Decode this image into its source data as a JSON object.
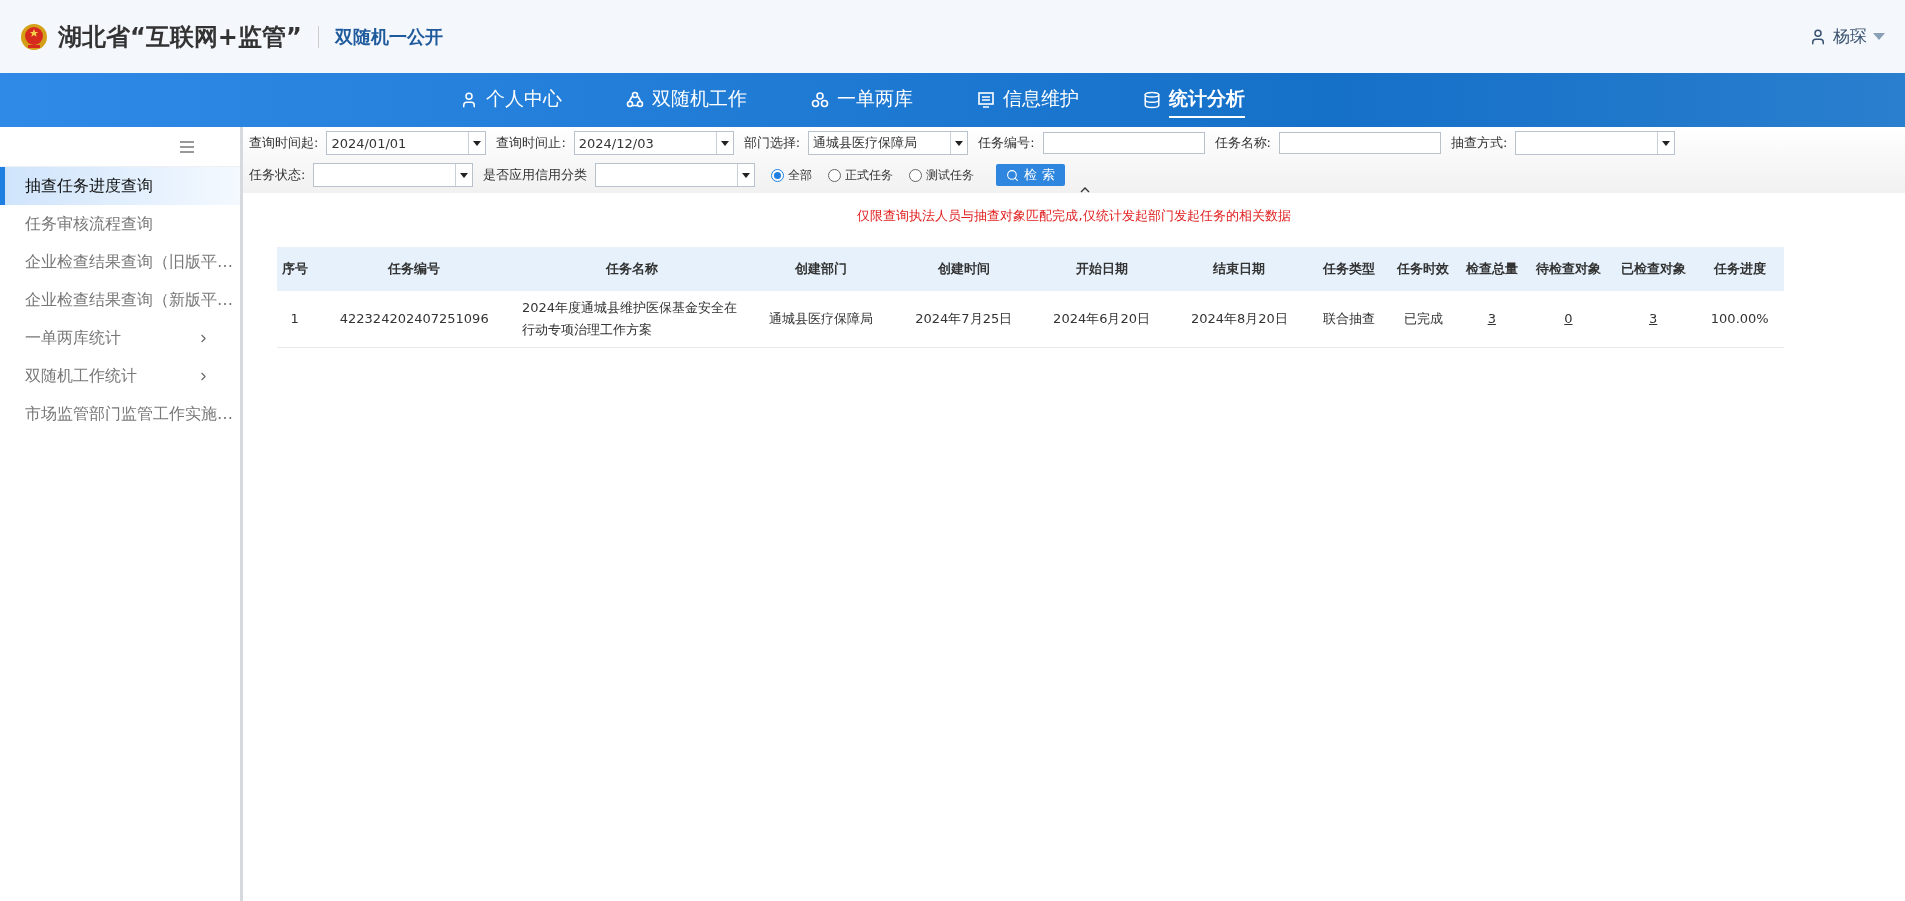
{
  "header": {
    "title": "湖北省“互联网+监管”",
    "subtitle": "双随机一公开",
    "user": "杨琛"
  },
  "nav": [
    {
      "label": "个人中心",
      "selected": false
    },
    {
      "label": "双随机工作",
      "selected": false
    },
    {
      "label": "一单两库",
      "selected": false
    },
    {
      "label": "信息维护",
      "selected": false
    },
    {
      "label": "统计分析",
      "selected": true
    }
  ],
  "sidebar": {
    "items": [
      {
        "label": "抽查任务进度查询",
        "kind": "link",
        "selected": true
      },
      {
        "label": "任务审核流程查询",
        "kind": "link",
        "selected": false
      },
      {
        "label": "企业检查结果查询（旧版平…",
        "kind": "link",
        "selected": false
      },
      {
        "label": "企业检查结果查询（新版平…",
        "kind": "link",
        "selected": false
      },
      {
        "label": "一单两库统计",
        "kind": "group",
        "selected": false
      },
      {
        "label": "双随机工作统计",
        "kind": "group",
        "selected": false
      },
      {
        "label": "市场监管部门监管工作实施…",
        "kind": "link",
        "selected": false
      }
    ]
  },
  "filters": {
    "rows": [
      [
        {
          "label": "查询时间起:",
          "kind": "select",
          "value": "2024/01/01"
        },
        {
          "label": "查询时间止:",
          "kind": "select",
          "value": "2024/12/03"
        },
        {
          "label": "部门选择:",
          "kind": "select",
          "value": "通城县医疗保障局"
        },
        {
          "label": "任务编号:",
          "kind": "input"
        },
        {
          "label": "任务名称:",
          "kind": "input"
        },
        {
          "label": "抽查方式:",
          "kind": "select"
        }
      ],
      [
        {
          "label": "任务状态:",
          "kind": "select"
        },
        {
          "label": "是否应用信用分类",
          "kind": "select"
        }
      ]
    ],
    "radios": [
      {
        "label": "全部",
        "selected": true
      },
      {
        "label": "正式任务",
        "selected": false
      },
      {
        "label": "测试任务",
        "selected": false
      }
    ],
    "search_button": "检 索"
  },
  "notice": "仅限查询执法人员与抽查对象匹配完成,仅统计发起部门发起任务的相关数据",
  "table": {
    "columns": [
      {
        "label": "序号",
        "kind": "text"
      },
      {
        "label": "任务编号",
        "kind": "text"
      },
      {
        "label": "任务名称",
        "kind": "wide"
      },
      {
        "label": "创建部门",
        "kind": "text"
      },
      {
        "label": "创建时间",
        "kind": "text"
      },
      {
        "label": "开始日期",
        "kind": "text"
      },
      {
        "label": "结束日期",
        "kind": "text"
      },
      {
        "label": "任务类型",
        "kind": "text"
      },
      {
        "label": "任务时效",
        "kind": "text"
      },
      {
        "label": "检查总量",
        "kind": "link"
      },
      {
        "label": "待检查对象",
        "kind": "link"
      },
      {
        "label": "已检查对象",
        "kind": "link"
      },
      {
        "label": "任务进度",
        "kind": "text"
      }
    ],
    "rows": [
      [
        "1",
        "422324202407251096",
        "2024年度通城县维护医保基金安全在行动专项治理工作方案",
        "通城县医疗保障局",
        "2024年7月25日",
        "2024年6月20日",
        "2024年8月20日",
        "联合抽查",
        "已完成",
        "3",
        "0",
        "3",
        "100.00%"
      ]
    ]
  }
}
